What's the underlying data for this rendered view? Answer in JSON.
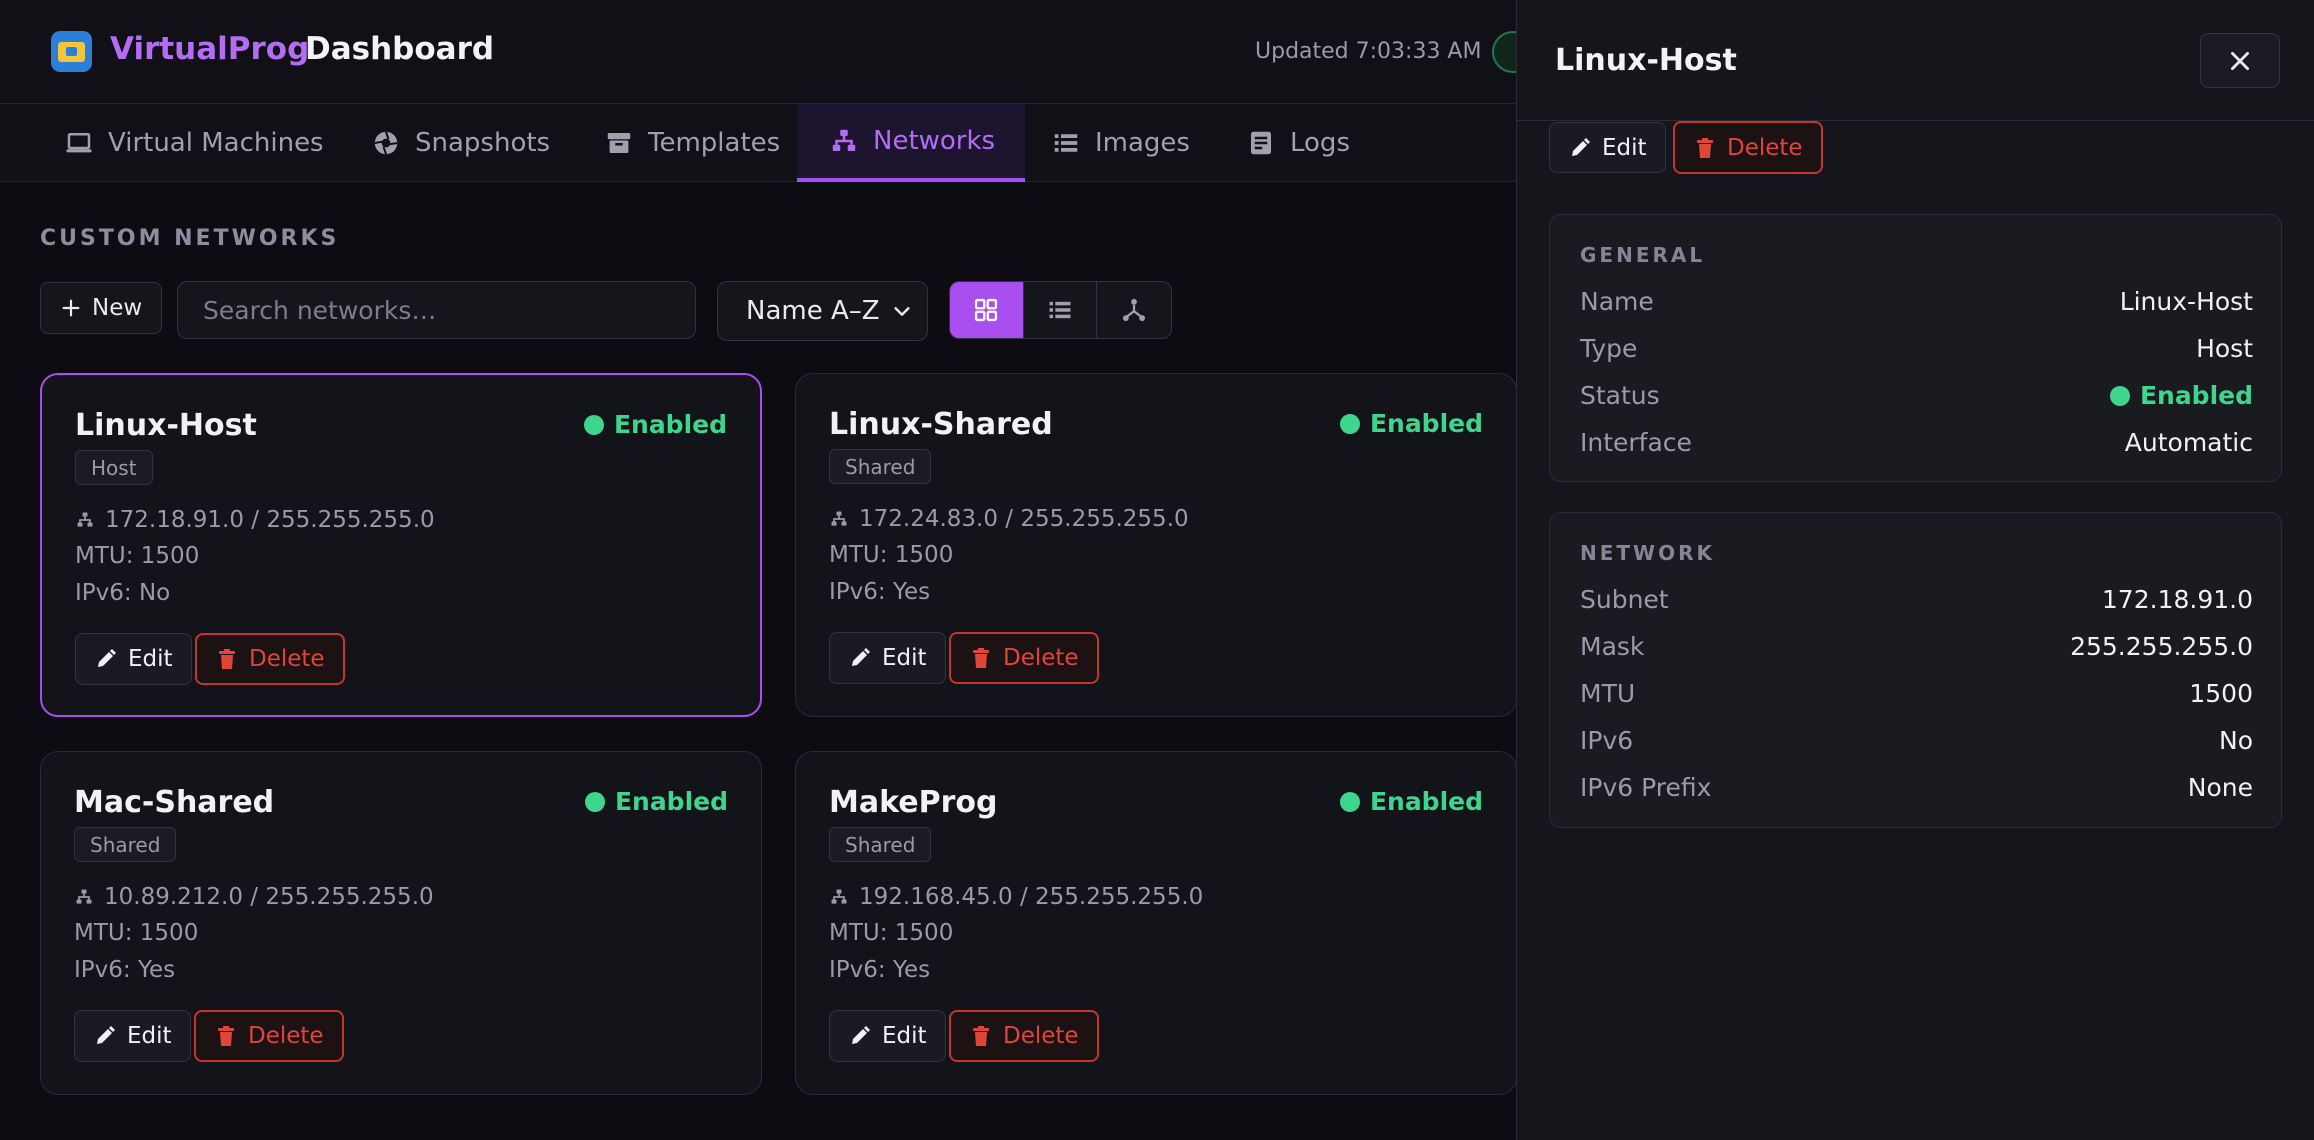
{
  "header": {
    "brand": "VirtualProg",
    "title": "Dashboard",
    "updated": "Updated 7:03:33 AM"
  },
  "tabs": [
    {
      "label": "Virtual Machines",
      "icon": "laptop-icon",
      "active": false
    },
    {
      "label": "Snapshots",
      "icon": "aperture-icon",
      "active": false
    },
    {
      "label": "Templates",
      "icon": "archive-icon",
      "active": false
    },
    {
      "label": "Networks",
      "icon": "network-icon",
      "active": true
    },
    {
      "label": "Images",
      "icon": "list-icon",
      "active": false
    },
    {
      "label": "Logs",
      "icon": "log-icon",
      "active": false
    }
  ],
  "main": {
    "section_title": "CUSTOM NETWORKS",
    "new_label": "New",
    "search_placeholder": "Search networks…",
    "sort_value": "Name A–Z",
    "views": [
      "grid",
      "list",
      "topology"
    ],
    "active_view": "grid",
    "cards": [
      {
        "name": "Linux-Host",
        "status": "Enabled",
        "type": "Host",
        "network": "172.18.91.0 / 255.255.255.0",
        "mtu": "MTU: 1500",
        "ipv6": "IPv6: No",
        "edit": "Edit",
        "delete": "Delete",
        "selected": true
      },
      {
        "name": "Linux-Shared",
        "status": "Enabled",
        "type": "Shared",
        "network": "172.24.83.0 / 255.255.255.0",
        "mtu": "MTU: 1500",
        "ipv6": "IPv6: Yes",
        "edit": "Edit",
        "delete": "Delete",
        "selected": false
      },
      {
        "name": "Mac-Shared",
        "status": "Enabled",
        "type": "Shared",
        "network": "10.89.212.0 / 255.255.255.0",
        "mtu": "MTU: 1500",
        "ipv6": "IPv6: Yes",
        "edit": "Edit",
        "delete": "Delete",
        "selected": false
      },
      {
        "name": "MakeProg",
        "status": "Enabled",
        "type": "Shared",
        "network": "192.168.45.0 / 255.255.255.0",
        "mtu": "MTU: 1500",
        "ipv6": "IPv6: Yes",
        "edit": "Edit",
        "delete": "Delete",
        "selected": false
      }
    ]
  },
  "panel": {
    "title": "Linux-Host",
    "edit": "Edit",
    "delete": "Delete",
    "general": {
      "title": "GENERAL",
      "rows": [
        {
          "k": "Name",
          "v": "Linux-Host"
        },
        {
          "k": "Type",
          "v": "Host"
        },
        {
          "k": "Status",
          "v": "Enabled"
        },
        {
          "k": "Interface",
          "v": "Automatic"
        }
      ]
    },
    "network": {
      "title": "NETWORK",
      "rows": [
        {
          "k": "Subnet",
          "v": "172.18.91.0"
        },
        {
          "k": "Mask",
          "v": "255.255.255.0"
        },
        {
          "k": "MTU",
          "v": "1500"
        },
        {
          "k": "IPv6",
          "v": "No"
        },
        {
          "k": "IPv6 Prefix",
          "v": "None"
        }
      ]
    }
  },
  "colors": {
    "accent": "#a94ff0",
    "enabled": "#3dd68c",
    "danger": "#e0453a"
  }
}
